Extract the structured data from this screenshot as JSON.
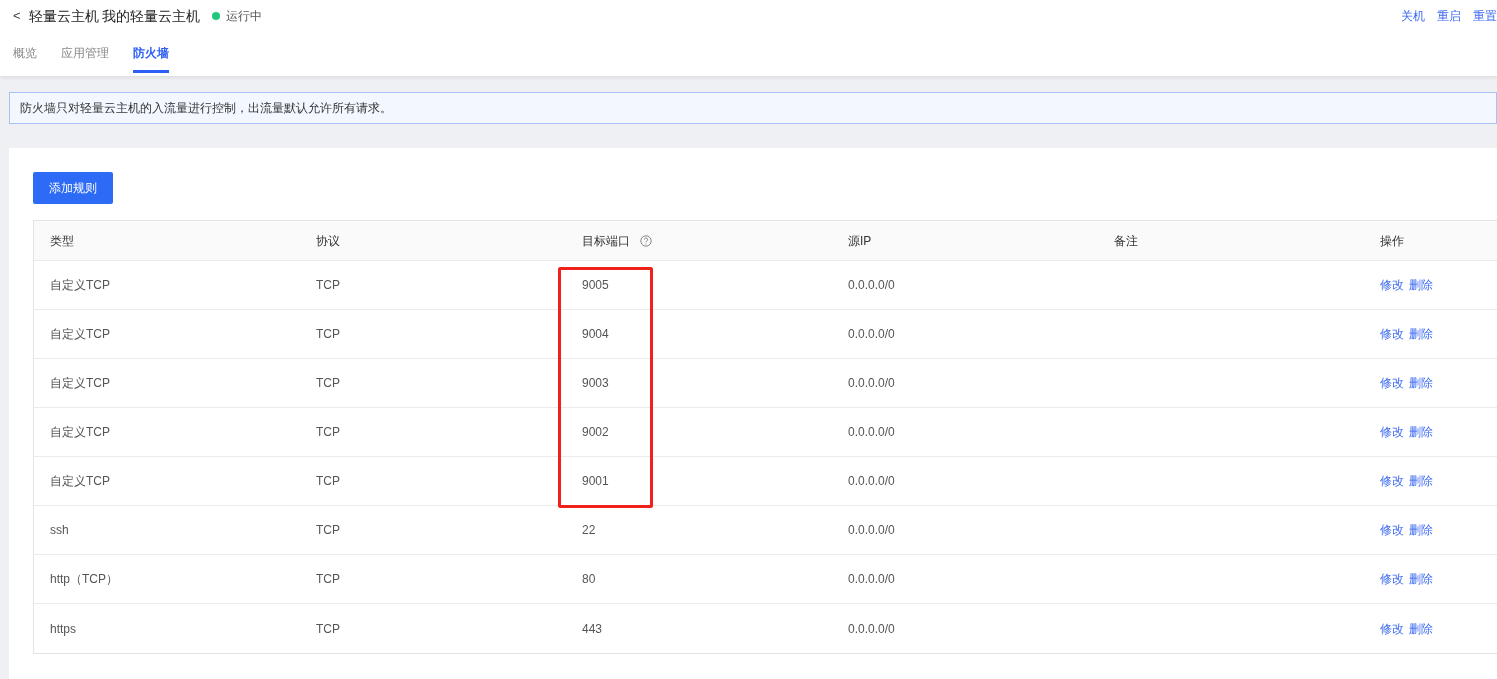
{
  "header": {
    "back": "<",
    "title": "轻量云主机 我的轻量云主机",
    "status": {
      "label": "运行中",
      "color": "#1ec77a"
    },
    "actions": [
      "关机",
      "重启",
      "重置"
    ]
  },
  "tabs": [
    {
      "label": "概览",
      "selected": false
    },
    {
      "label": "应用管理",
      "selected": false
    },
    {
      "label": "防火墙",
      "selected": true
    }
  ],
  "notice": "防火墙只对轻量云主机的入流量进行控制，出流量默认允许所有请求。",
  "add_button": "添加规则",
  "table": {
    "columns": [
      "类型",
      "协议",
      "目标端口",
      "源IP",
      "备注",
      "操作"
    ],
    "rows": [
      {
        "type": "自定义TCP",
        "protocol": "TCP",
        "port": "9005",
        "source": "0.0.0.0/0",
        "actions": [
          "修改",
          "删除"
        ],
        "highlighted": true
      },
      {
        "type": "自定义TCP",
        "protocol": "TCP",
        "port": "9004",
        "source": "0.0.0.0/0",
        "actions": [
          "修改",
          "删除"
        ],
        "highlighted": true
      },
      {
        "type": "自定义TCP",
        "protocol": "TCP",
        "port": "9003",
        "source": "0.0.0.0/0",
        "actions": [
          "修改",
          "删除"
        ],
        "highlighted": true
      },
      {
        "type": "自定义TCP",
        "protocol": "TCP",
        "port": "9002",
        "source": "0.0.0.0/0",
        "actions": [
          "修改",
          "删除"
        ],
        "highlighted": true
      },
      {
        "type": "自定义TCP",
        "protocol": "TCP",
        "port": "9001",
        "source": "0.0.0.0/0",
        "actions": [
          "修改",
          "删除"
        ],
        "highlighted": true
      },
      {
        "type": "ssh",
        "protocol": "TCP",
        "port": "22",
        "source": "0.0.0.0/0",
        "actions": [
          "修改",
          "删除"
        ],
        "highlighted": false
      },
      {
        "type": "http（TCP）",
        "protocol": "TCP",
        "port": "80",
        "source": "0.0.0.0/0",
        "actions": [
          "修改",
          "删除"
        ],
        "highlighted": false
      },
      {
        "type": "https",
        "protocol": "TCP",
        "port": "443",
        "source": "0.0.0.0/0",
        "actions": [
          "修改",
          "删除"
        ],
        "highlighted": false
      }
    ]
  }
}
